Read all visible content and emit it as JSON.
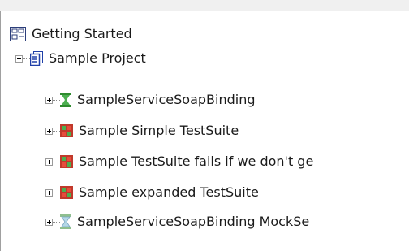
{
  "tree": {
    "root": {
      "label": "Getting Started",
      "icon": "workspace-icon"
    },
    "project": {
      "label": "Sample Project",
      "icon": "project-icon",
      "expanded": true
    },
    "children": [
      {
        "label": "SampleServiceSoapBinding",
        "icon": "interface-icon"
      },
      {
        "label": "Sample Simple TestSuite",
        "icon": "testsuite-icon"
      },
      {
        "label": "Sample TestSuite fails if we don't ge",
        "icon": "testsuite-icon"
      },
      {
        "label": "Sample expanded TestSuite",
        "icon": "testsuite-icon"
      },
      {
        "label": "SampleServiceSoapBinding MockSe",
        "icon": "mockservice-icon"
      }
    ]
  },
  "colors": {
    "interface_green": "#2e8b2e",
    "testsuite_red": "#c0392b",
    "testsuite_green": "#3a9a3a",
    "project_blue": "#1f3fa8"
  }
}
